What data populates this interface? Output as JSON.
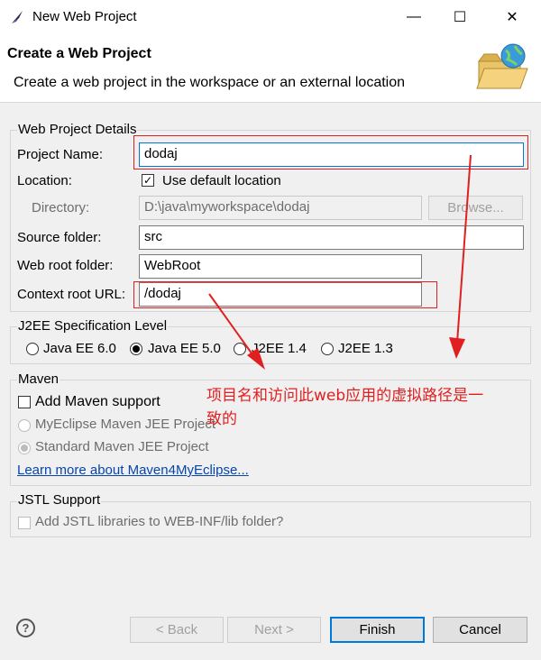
{
  "window": {
    "title": "New Web Project",
    "minimize": "—",
    "maximize": "☐",
    "close": "✕"
  },
  "banner": {
    "title": "Create a Web Project",
    "description": "Create a web project in the workspace or an external location"
  },
  "details": {
    "group_label": "Web Project Details",
    "project_name_label": "Project Name:",
    "project_name_value": "dodaj",
    "location_label": "Location:",
    "use_default_label": "Use default location",
    "use_default_checked": "✓",
    "directory_label": "Directory:",
    "directory_value": "D:\\java\\myworkspace\\dodaj",
    "browse_label": "Browse...",
    "source_folder_label": "Source folder:",
    "source_folder_value": "src",
    "web_root_label": "Web root folder:",
    "web_root_value": "WebRoot",
    "context_root_label": "Context root URL:",
    "context_root_value": "/dodaj"
  },
  "j2ee": {
    "group_label": "J2EE Specification Level",
    "options": [
      "Java EE 6.0",
      "Java EE 5.0",
      "J2EE 1.4",
      "J2EE 1.3"
    ],
    "selected": "Java EE 5.0"
  },
  "maven": {
    "group_label": "Maven",
    "add_support_label": "Add Maven support",
    "myeclipse_project_label": "MyEclipse Maven JEE Project",
    "standard_project_label": "Standard Maven JEE Project",
    "learn_more_link": "Learn more about Maven4MyEclipse..."
  },
  "jstl": {
    "group_label": "JSTL Support",
    "add_libraries_label": "Add JSTL libraries to WEB-INF/lib folder?"
  },
  "annotation": {
    "text_line1": "项目名和访问此web应用的虚拟路径是一",
    "text_line2": "致的"
  },
  "footer": {
    "help": "?",
    "back_label": "< Back",
    "next_label": "Next >",
    "finish_label": "Finish",
    "cancel_label": "Cancel"
  },
  "colors": {
    "annotation_red": "#e02020",
    "focus_blue": "#0078d7",
    "link_blue": "#0645ad"
  },
  "icons": [
    "eclipse-app-icon",
    "folder-globe-icon",
    "help-icon"
  ]
}
